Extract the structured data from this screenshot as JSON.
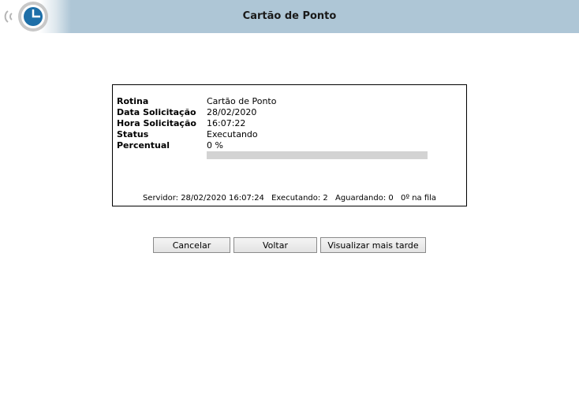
{
  "header": {
    "title": "Cartão de Ponto",
    "logo_icon": "clock-signal-logo",
    "background_color": "#aec6d6"
  },
  "job": {
    "fields": [
      {
        "label": "Rotina",
        "value": "Cartão de Ponto"
      },
      {
        "label": "Data Solicitação",
        "value": "28/02/2020"
      },
      {
        "label": "Hora Solicitação",
        "value": "16:07:22"
      },
      {
        "label": "Status",
        "value": "Executando"
      },
      {
        "label": "Percentual",
        "value": "0 %"
      }
    ],
    "progress_percent": 0
  },
  "footer": {
    "server": "Servidor: 28/02/2020 16:07:24",
    "running": "Executando: 2",
    "waiting": "Aguardando: 0",
    "queue": "0º na fila"
  },
  "actions": {
    "cancel_label": "Cancelar",
    "back_label": "Voltar",
    "later_label": "Visualizar mais tarde"
  }
}
